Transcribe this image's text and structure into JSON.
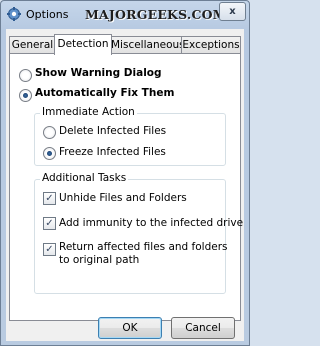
{
  "window": {
    "title": "Options",
    "watermark": "MAJORGEEKS.COM",
    "close_glyph": "x"
  },
  "tabs": [
    "General",
    "Detection",
    "Miscellaneous",
    "Exceptions"
  ],
  "active_tab": "Detection",
  "mode": {
    "show_warning_label": "Show Warning Dialog",
    "auto_fix_label": "Automatically Fix Them",
    "selected": "Automatically Fix Them"
  },
  "immediate_action": {
    "title": "Immediate Action",
    "delete_label": "Delete Infected Files",
    "freeze_label": "Freeze Infected Files",
    "selected": "Freeze Infected Files"
  },
  "additional_tasks": {
    "title": "Additional Tasks",
    "items": [
      {
        "label": "Unhide Files and Folders",
        "checked": true
      },
      {
        "label": "Add immunity to the infected drive",
        "checked": true
      },
      {
        "label_line1": "Return affected files and folders",
        "label_line2": "to original path",
        "checked": true
      }
    ]
  },
  "buttons": {
    "ok": "OK",
    "cancel": "Cancel"
  },
  "icons": {
    "app": "options-gear-icon",
    "check": "checkmark-icon",
    "close": "close-icon"
  }
}
